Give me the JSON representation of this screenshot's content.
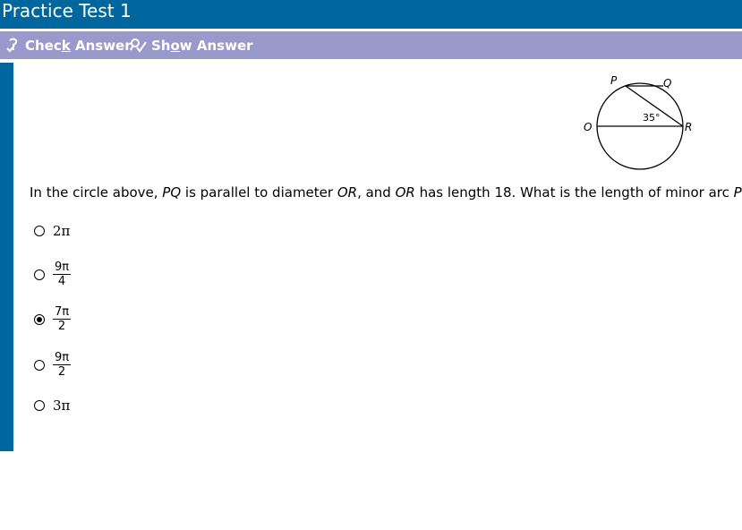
{
  "window": {
    "title": "Practice Test 1"
  },
  "toolbar": {
    "check_pre": "Chec",
    "check_ul": "k",
    "check_post": " Answer",
    "show_pre": "Sh",
    "show_ul": "o",
    "show_post": "w Answer"
  },
  "figure": {
    "label_p": "P",
    "label_q": "Q",
    "label_o": "O",
    "label_r": "R",
    "angle_label": "35°"
  },
  "question": {
    "part1": "In the circle above, ",
    "pq1": "PQ",
    "part2": " is parallel to diameter ",
    "or1": "OR",
    "part3": ", and ",
    "or2": "OR",
    "part4": " has length 18.  What is the length of minor arc ",
    "pq2": "PQ",
    "part5": " ?"
  },
  "choices": [
    {
      "text": "2π",
      "selected": false
    },
    {
      "num": "9π",
      "den": "4",
      "selected": false
    },
    {
      "num": "7π",
      "den": "2",
      "selected": true
    },
    {
      "num": "9π",
      "den": "2",
      "selected": false
    },
    {
      "text": "3π",
      "selected": false
    }
  ]
}
